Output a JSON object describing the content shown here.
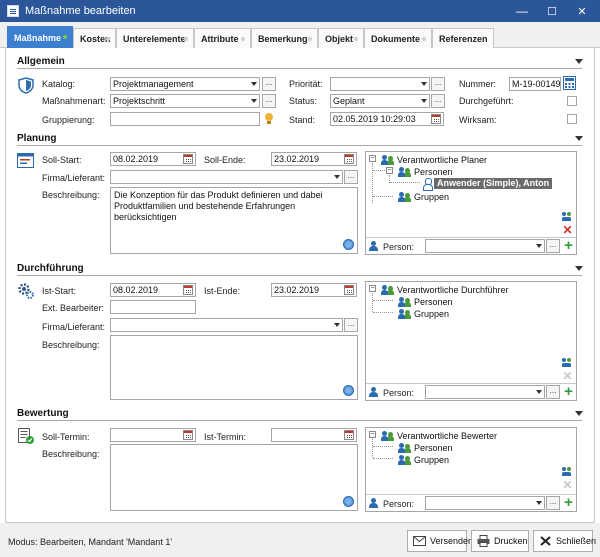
{
  "window": {
    "title": "Maßnahme bearbeiten",
    "minimize": "—",
    "maximize": "☐",
    "close": "✕"
  },
  "tabs": [
    "Maßnahme",
    "Kosten",
    "Unterelemente",
    "Attribute",
    "Bemerkung",
    "Objekt",
    "Dokumente",
    "Referenzen"
  ],
  "allgemein": {
    "title": "Allgemein",
    "katalog_label": "Katalog:",
    "katalog_value": "Projektmanagement",
    "massnahmenart_label": "Maßnahmenart:",
    "massnahmenart_value": "Projektschritt",
    "gruppierung_label": "Gruppierung:",
    "gruppierung_value": "",
    "prioritaet_label": "Priorität:",
    "prioritaet_value": "",
    "status_label": "Status:",
    "status_value": "Geplant",
    "stand_label": "Stand:",
    "stand_value": "02.05.2019 10:29:03",
    "nummer_label": "Nummer:",
    "nummer_value": "M-19-00149",
    "durchgefuehrt_label": "Durchgeführt:",
    "wirksam_label": "Wirksam:"
  },
  "planung": {
    "title": "Planung",
    "soll_start_label": "Soll-Start:",
    "soll_start_value": "08.02.2019",
    "soll_ende_label": "Soll-Ende:",
    "soll_ende_value": "23.02.2019",
    "firma_label": "Firma/Lieferant:",
    "firma_value": "",
    "beschreibung_label": "Beschreibung:",
    "beschreibung_value": "Die Konzeption für das Produkt definieren und dabei Produktfamilien und bestehende Erfahrungen  berücksichtigen",
    "tree_root": "Verantwortliche Planer",
    "tree_personen": "Personen",
    "tree_person_selected": "Anwender (Simple), Anton",
    "tree_gruppen": "Gruppen",
    "person_label": "Person:",
    "person_value": ""
  },
  "durchfuehrung": {
    "title": "Durchführung",
    "ist_start_label": "Ist-Start:",
    "ist_start_value": "08.02.2019",
    "ist_ende_label": "Ist-Ende:",
    "ist_ende_value": "23.02.2019",
    "ext_bearbeiter_label": "Ext. Bearbeiter:",
    "ext_bearbeiter_value": "",
    "firma_label": "Firma/Lieferant:",
    "firma_value": "",
    "beschreibung_label": "Beschreibung:",
    "beschreibung_value": "",
    "tree_root": "Verantwortliche Durchführer",
    "tree_personen": "Personen",
    "tree_gruppen": "Gruppen",
    "person_label": "Person:",
    "person_value": ""
  },
  "bewertung": {
    "title": "Bewertung",
    "soll_termin_label": "Soll-Termin:",
    "soll_termin_value": "",
    "ist_termin_label": "Ist-Termin:",
    "ist_termin_value": "",
    "beschreibung_label": "Beschreibung:",
    "beschreibung_value": "",
    "tree_root": "Verantwortliche Bewerter",
    "tree_personen": "Personen",
    "tree_gruppen": "Gruppen",
    "person_label": "Person:",
    "person_value": ""
  },
  "statusbar": {
    "text": "Modus: Bearbeiten, Mandant 'Mandant 1'",
    "versenden": "Versenden",
    "drucken": "Drucken",
    "schliessen": "Schließen"
  },
  "ellipsis": "...",
  "colors": {
    "accent": "#3c7fd1",
    "titlebar": "#2b579a",
    "success": "#2e9d3a",
    "danger": "#d0302a"
  }
}
